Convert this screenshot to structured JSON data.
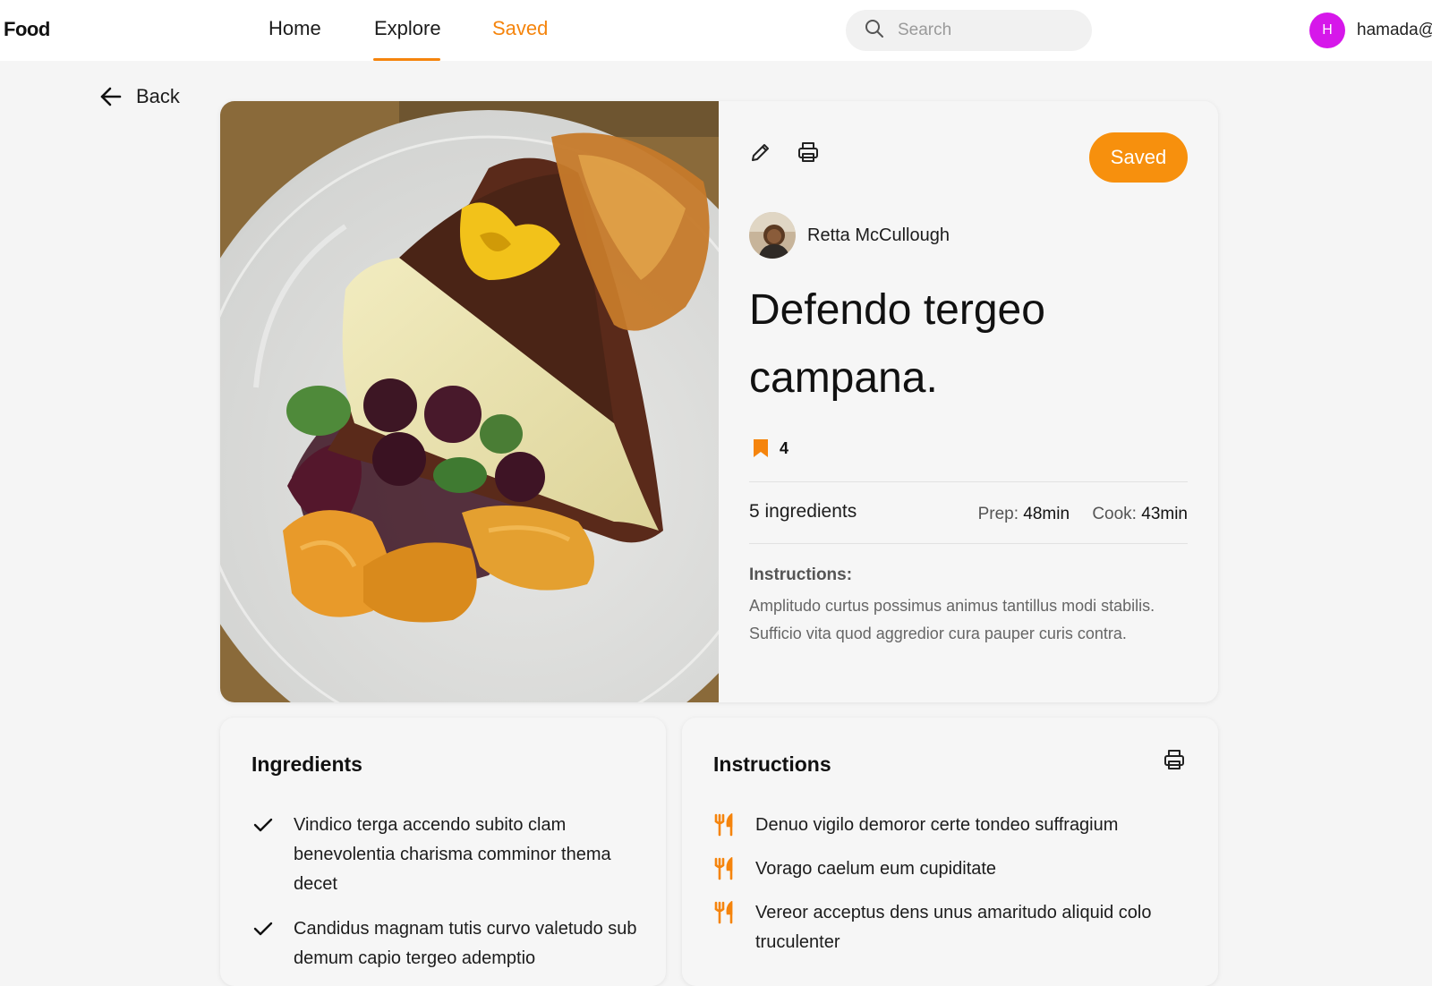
{
  "nav": {
    "logo": "Food",
    "links": [
      {
        "label": "Home",
        "active": false
      },
      {
        "label": "Explore",
        "active": true
      },
      {
        "label": "Saved",
        "active": false,
        "highlight": "#f5840c"
      }
    ],
    "search": {
      "placeholder": "Search",
      "value": ""
    },
    "user": {
      "initial": "H",
      "name": "hamada@",
      "avatar_color": "#d617ea"
    }
  },
  "back": {
    "label": "Back",
    "icon": "arrow-left-icon"
  },
  "recipe": {
    "toolbar": {
      "edit_icon": "pencil-icon",
      "print_icon": "printer-icon",
      "saved_label": "Saved"
    },
    "author": {
      "name": "Retta McCullough"
    },
    "title": "Defendo tergeo campana.",
    "save_count": "4",
    "ingredient_count": "5 ingredients",
    "prep_label": "Prep:",
    "prep_value": "48min",
    "cook_label": "Cook:",
    "cook_value": "43min",
    "instructions_label": "Instructions:",
    "instructions_text": "Amplitudo curtus possimus animus tantillus modi stabilis. Sufficio vita quod aggredior cura pauper curis contra."
  },
  "ingredients_card": {
    "title": "Ingredients",
    "items": [
      "Vindico terga accendo subito clam benevolentia charisma comminor thema decet",
      "Candidus magnam tutis curvo valetudo sub demum capio tergeo ademptio"
    ]
  },
  "instructions_card": {
    "title": "Instructions",
    "print_icon": "printer-icon",
    "steps": [
      "Denuo vigilo demoror certe tondeo suffragium",
      "Vorago caelum eum cupiditate",
      "Vereor acceptus dens unus amaritudo aliquid colo truculenter"
    ]
  },
  "colors": {
    "accent": "#f5840c",
    "saved_button": "#f7900d",
    "background": "#f5f5f5"
  }
}
